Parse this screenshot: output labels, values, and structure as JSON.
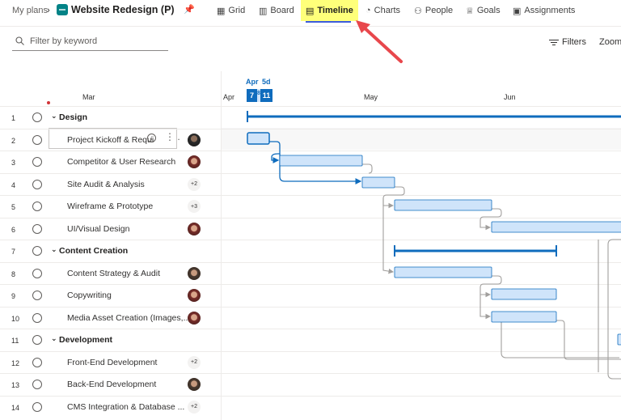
{
  "nav": {
    "breadcrumb": "My plans",
    "plan_title": "Website Redesign (P)",
    "tabs": [
      {
        "label": "Grid",
        "icon": "grid-icon"
      },
      {
        "label": "Board",
        "icon": "board-icon"
      },
      {
        "label": "Timeline",
        "icon": "timeline-icon",
        "active": true
      },
      {
        "label": "Charts",
        "icon": "charts-icon"
      },
      {
        "label": "People",
        "icon": "people-icon"
      },
      {
        "label": "Goals",
        "icon": "goals-icon"
      },
      {
        "label": "Assignments",
        "icon": "assignments-icon"
      }
    ]
  },
  "toolbar": {
    "filter_placeholder": "Filter by keyword",
    "filters_label": "Filters",
    "zoom_label": "Zoom"
  },
  "timeline": {
    "months": [
      "Mar",
      "Apr",
      "May",
      "Jun"
    ],
    "today": {
      "label_apr": "Apr",
      "label_5d": "5d",
      "day_start": "7",
      "day_sep": "8",
      "day_end": "11"
    }
  },
  "rows": [
    {
      "num": "1",
      "type": "group",
      "title": "Design"
    },
    {
      "num": "2",
      "type": "task",
      "title": "Project Kickoff & Requi",
      "assignee": "avatar-dark"
    },
    {
      "num": "3",
      "type": "task",
      "title": "Competitor & User Research",
      "assignee": "avatar-red"
    },
    {
      "num": "4",
      "type": "task",
      "title": "Site Audit & Analysis",
      "badge": "+2"
    },
    {
      "num": "5",
      "type": "task",
      "title": "Wireframe & Prototype",
      "badge": "+3"
    },
    {
      "num": "6",
      "type": "task",
      "title": "UI/Visual Design",
      "assignee": "avatar-red"
    },
    {
      "num": "7",
      "type": "group",
      "title": "Content Creation"
    },
    {
      "num": "8",
      "type": "task",
      "title": "Content Strategy & Audit",
      "assignee": "avatar-man"
    },
    {
      "num": "9",
      "type": "task",
      "title": "Copywriting",
      "assignee": "avatar-red"
    },
    {
      "num": "10",
      "type": "task",
      "title": "Media Asset Creation (Images,...",
      "assignee": "avatar-red"
    },
    {
      "num": "11",
      "type": "group",
      "title": "Development"
    },
    {
      "num": "12",
      "type": "task",
      "title": "Front-End Development",
      "badge": "+2"
    },
    {
      "num": "13",
      "type": "task",
      "title": "Back-End Development",
      "assignee": "avatar-man"
    },
    {
      "num": "14",
      "type": "task",
      "title": "CMS Integration & Database ...",
      "badge": "+2"
    }
  ],
  "colors": {
    "accent": "#0f6cbd",
    "bar_fill": "#cfe4fa",
    "highlight": "#ffff7a",
    "arrow": "#e8474c",
    "link_gray": "#a19f9d"
  }
}
